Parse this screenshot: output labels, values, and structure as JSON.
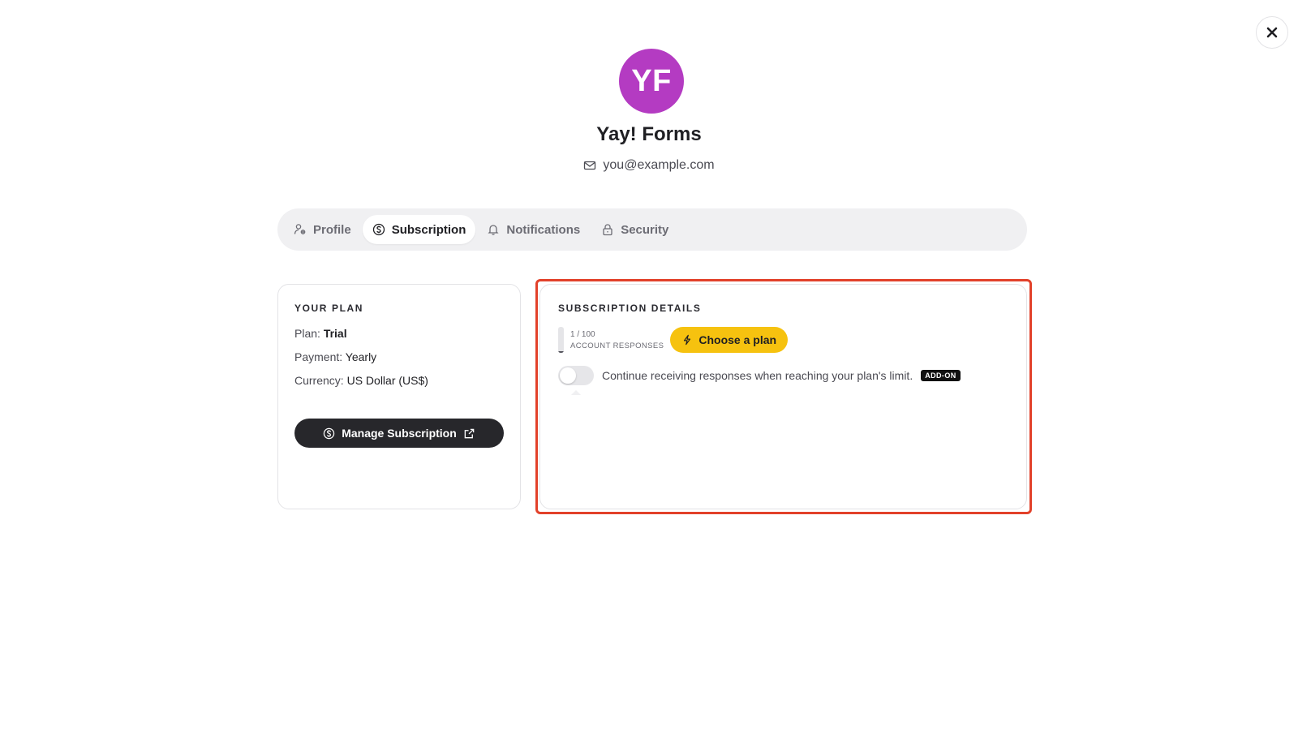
{
  "header": {
    "avatar_initials": "YF",
    "avatar_color": "#b43bc2",
    "display_name": "Yay! Forms",
    "email": "you@example.com"
  },
  "tabs": [
    {
      "label": "Profile",
      "icon": "user-settings-icon",
      "active": false
    },
    {
      "label": "Subscription",
      "icon": "dollar-circle-icon",
      "active": true
    },
    {
      "label": "Notifications",
      "icon": "bell-icon",
      "active": false
    },
    {
      "label": "Security",
      "icon": "lock-icon",
      "active": false
    }
  ],
  "plan_card": {
    "title": "YOUR PLAN",
    "plan_label": "Plan:",
    "plan_value": "Trial",
    "payment_label": "Payment:",
    "payment_value": "Yearly",
    "currency_label": "Currency:",
    "currency_value": "US Dollar (US$)",
    "manage_button": "Manage Subscription"
  },
  "subscription_card": {
    "title": "SUBSCRIPTION DETAILS",
    "usage_count": "1 / 100",
    "usage_label": "ACCOUNT RESPONSES",
    "usage_used": 1,
    "usage_total": 100,
    "choose_plan_button": "Choose a plan",
    "toggle_text": "Continue receiving responses when reaching your plan's limit.",
    "toggle_on": false,
    "addon_badge": "ADD-ON"
  },
  "colors": {
    "accent_yellow": "#f6c20f",
    "highlight_red": "#e2412a",
    "dark_button": "#27272b"
  }
}
